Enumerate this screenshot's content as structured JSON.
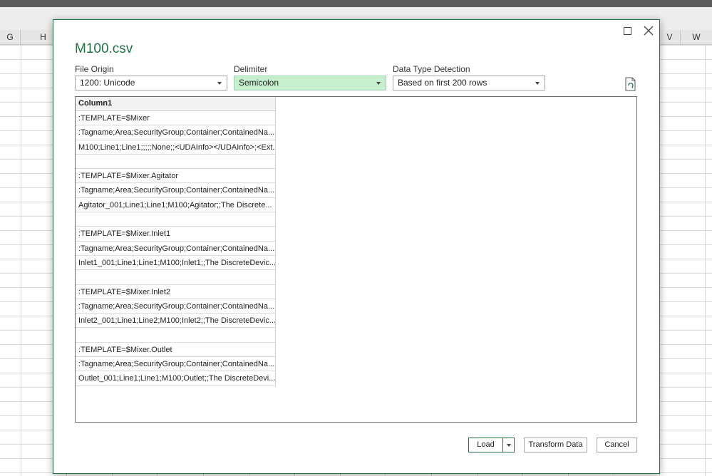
{
  "sheet": {
    "columns": [
      {
        "label": "G"
      },
      {
        "label": "H"
      },
      {
        "label": "V"
      },
      {
        "label": "W"
      }
    ]
  },
  "dialog": {
    "title": "M100.csv",
    "file_origin": {
      "label": "File Origin",
      "value": "1200: Unicode"
    },
    "delimiter": {
      "label": "Delimiter",
      "value": "Semicolon"
    },
    "data_type_detection": {
      "label": "Data Type Detection",
      "value": "Based on first 200 rows"
    },
    "table": {
      "header": "Column1",
      "rows": [
        ":TEMPLATE=$Mixer",
        ":Tagname;Area;SecurityGroup;Container;ContainedNa...",
        "M100;Line1;Line1;;;;;None;;<UDAInfo></UDAInfo>;<Ext...",
        "",
        ":TEMPLATE=$Mixer.Agitator",
        ":Tagname;Area;SecurityGroup;Container;ContainedNa...",
        "Agitator_001;Line1;Line1;M100;Agitator;;The Discrete...",
        "",
        ":TEMPLATE=$Mixer.Inlet1",
        ":Tagname;Area;SecurityGroup;Container;ContainedNa...",
        "Inlet1_001;Line1;Line1;M100;Inlet1;;The DiscreteDevic...",
        "",
        ":TEMPLATE=$Mixer.Inlet2",
        ":Tagname;Area;SecurityGroup;Container;ContainedNa...",
        "Inlet2_001;Line1;Line2;M100;Inlet2;;The DiscreteDevic...",
        "",
        ":TEMPLATE=$Mixer.Outlet",
        ":Tagname;Area;SecurityGroup;Container;ContainedNa...",
        "Outlet_001;Line1;Line1;M100;Outlet;;The DiscreteDevi..."
      ]
    },
    "buttons": {
      "load": "Load",
      "transform": "Transform Data",
      "cancel": "Cancel"
    }
  },
  "colors": {
    "accent": "#217346",
    "highlight": "#c6efce"
  }
}
